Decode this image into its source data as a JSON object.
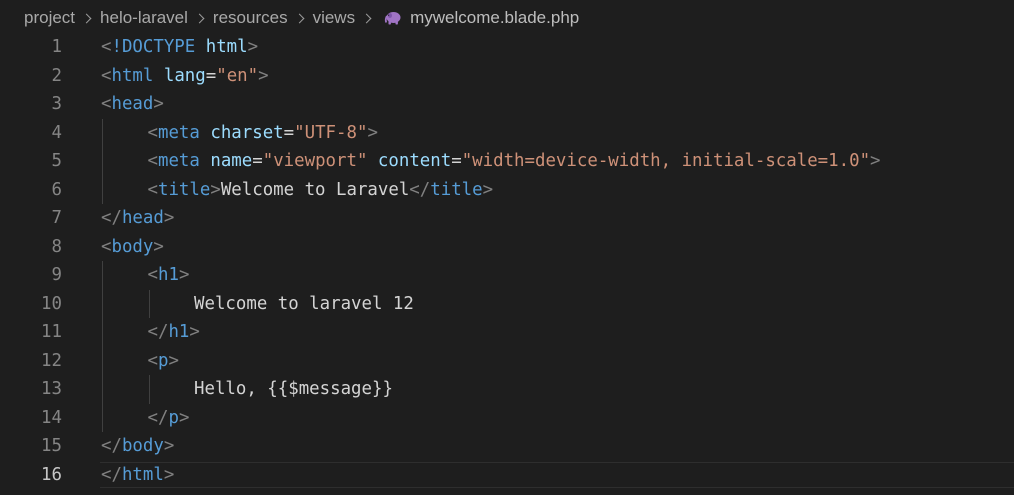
{
  "breadcrumb": {
    "items": [
      "project",
      "helo-laravel",
      "resources",
      "views"
    ],
    "file": "mywelcome.blade.php",
    "file_icon": "php-elephant-icon"
  },
  "editor": {
    "active_line": 16,
    "lines": [
      {
        "n": 1,
        "indent": 0,
        "tokens": [
          [
            "punc",
            "<"
          ],
          [
            "tag",
            "!DOCTYPE"
          ],
          [
            "text",
            " "
          ],
          [
            "attr",
            "html"
          ],
          [
            "punc",
            ">"
          ]
        ]
      },
      {
        "n": 2,
        "indent": 0,
        "tokens": [
          [
            "punc",
            "<"
          ],
          [
            "tag",
            "html"
          ],
          [
            "text",
            " "
          ],
          [
            "attr",
            "lang"
          ],
          [
            "text",
            "="
          ],
          [
            "str",
            "\"en\""
          ],
          [
            "punc",
            ">"
          ]
        ]
      },
      {
        "n": 3,
        "indent": 0,
        "tokens": [
          [
            "punc",
            "<"
          ],
          [
            "tag",
            "head"
          ],
          [
            "punc",
            ">"
          ]
        ]
      },
      {
        "n": 4,
        "indent": 1,
        "tokens": [
          [
            "punc",
            "<"
          ],
          [
            "tag",
            "meta"
          ],
          [
            "text",
            " "
          ],
          [
            "attr",
            "charset"
          ],
          [
            "text",
            "="
          ],
          [
            "str",
            "\"UTF-8\""
          ],
          [
            "punc",
            ">"
          ]
        ]
      },
      {
        "n": 5,
        "indent": 1,
        "tokens": [
          [
            "punc",
            "<"
          ],
          [
            "tag",
            "meta"
          ],
          [
            "text",
            " "
          ],
          [
            "attr",
            "name"
          ],
          [
            "text",
            "="
          ],
          [
            "str",
            "\"viewport\""
          ],
          [
            "text",
            " "
          ],
          [
            "attr",
            "content"
          ],
          [
            "text",
            "="
          ],
          [
            "str",
            "\"width=device-width, initial-scale=1.0\""
          ],
          [
            "punc",
            ">"
          ]
        ]
      },
      {
        "n": 6,
        "indent": 1,
        "tokens": [
          [
            "punc",
            "<"
          ],
          [
            "tag",
            "title"
          ],
          [
            "punc",
            ">"
          ],
          [
            "text",
            "Welcome to Laravel"
          ],
          [
            "punc",
            "</"
          ],
          [
            "tag",
            "title"
          ],
          [
            "punc",
            ">"
          ]
        ]
      },
      {
        "n": 7,
        "indent": 0,
        "tokens": [
          [
            "punc",
            "</"
          ],
          [
            "tag",
            "head"
          ],
          [
            "punc",
            ">"
          ]
        ]
      },
      {
        "n": 8,
        "indent": 0,
        "tokens": [
          [
            "punc",
            "<"
          ],
          [
            "tag",
            "body"
          ],
          [
            "punc",
            ">"
          ]
        ]
      },
      {
        "n": 9,
        "indent": 1,
        "tokens": [
          [
            "punc",
            "<"
          ],
          [
            "tag",
            "h1"
          ],
          [
            "punc",
            ">"
          ]
        ]
      },
      {
        "n": 10,
        "indent": 2,
        "tokens": [
          [
            "text",
            "Welcome to laravel 12"
          ]
        ]
      },
      {
        "n": 11,
        "indent": 1,
        "tokens": [
          [
            "punc",
            "</"
          ],
          [
            "tag",
            "h1"
          ],
          [
            "punc",
            ">"
          ]
        ]
      },
      {
        "n": 12,
        "indent": 1,
        "tokens": [
          [
            "punc",
            "<"
          ],
          [
            "tag",
            "p"
          ],
          [
            "punc",
            ">"
          ]
        ]
      },
      {
        "n": 13,
        "indent": 2,
        "tokens": [
          [
            "text",
            "Hello, {{$message}}"
          ]
        ]
      },
      {
        "n": 14,
        "indent": 1,
        "tokens": [
          [
            "punc",
            "</"
          ],
          [
            "tag",
            "p"
          ],
          [
            "punc",
            ">"
          ]
        ]
      },
      {
        "n": 15,
        "indent": 0,
        "tokens": [
          [
            "punc",
            "</"
          ],
          [
            "tag",
            "body"
          ],
          [
            "punc",
            ">"
          ]
        ]
      },
      {
        "n": 16,
        "indent": 0,
        "tokens": [
          [
            "punc",
            "</"
          ],
          [
            "tag",
            "html"
          ],
          [
            "punc",
            ">"
          ]
        ]
      }
    ]
  }
}
